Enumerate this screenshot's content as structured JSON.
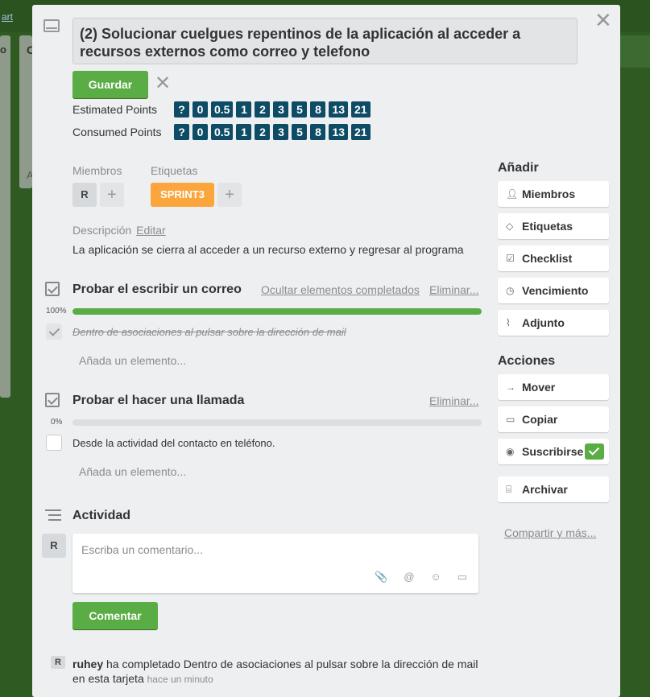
{
  "background": {
    "top_link": "art",
    "list_letter_1": "o",
    "list_letter_2": "C",
    "list_letter_3": "A"
  },
  "card": {
    "title": "(2) Solucionar cuelgues repentinos de la aplicación al acceder a recursos externos como correo y telefono",
    "save_label": "Guardar",
    "estimated_label": "Estimated Points",
    "consumed_label": "Consumed Points",
    "points": [
      "?",
      "0",
      "0.5",
      "1",
      "2",
      "3",
      "5",
      "8",
      "13",
      "21"
    ],
    "members_label": "Miembros",
    "member_avatar": "R",
    "labels_label": "Etiquetas",
    "label_sprint": "SPRINT3",
    "plus": "+",
    "description_label": "Descripción",
    "description_edit": "Editar",
    "description_text": "La aplicación se cierra al acceder a un recurso externo y regresar al programa"
  },
  "checklists": [
    {
      "title": "Probar el escribir un correo",
      "hide_completed": "Ocultar elementos completados",
      "delete": "Eliminar...",
      "percent_label": "100%",
      "progress": 1.0,
      "items": [
        {
          "text": "Dentro de asociaciones al pulsar sobre la dirección de mail",
          "done": true
        }
      ],
      "add_item": "Añada un elemento..."
    },
    {
      "title": "Probar el hacer una llamada",
      "delete": "Eliminar...",
      "percent_label": "0%",
      "progress": 0.0,
      "items": [
        {
          "text": "Desde la actividad del contacto en teléfono.",
          "done": false
        }
      ],
      "add_item": "Añada un elemento..."
    }
  ],
  "activity": {
    "title": "Actividad",
    "avatar": "R",
    "comment_placeholder": "Escriba un comentario...",
    "comment_button": "Comentar",
    "log_user": "ruhey",
    "log_text": "ha completado Dentro de asociaciones al pulsar sobre la dirección de mail en esta tarjeta",
    "log_time": "hace un minuto",
    "log_avatar": "R"
  },
  "sidebar": {
    "add_title": "Añadir",
    "add_items": [
      {
        "label": "Miembros",
        "icon": "person-icon"
      },
      {
        "label": "Etiquetas",
        "icon": "tag-icon"
      },
      {
        "label": "Checklist",
        "icon": "checklist-icon"
      },
      {
        "label": "Vencimiento",
        "icon": "clock-icon"
      },
      {
        "label": "Adjunto",
        "icon": "paperclip-icon"
      }
    ],
    "actions_title": "Acciones",
    "action_items": [
      {
        "label": "Mover",
        "icon": "arrow-right-icon"
      },
      {
        "label": "Copiar",
        "icon": "card-icon"
      },
      {
        "label": "Suscribirse",
        "icon": "eye-icon"
      },
      {
        "label": "Archivar",
        "icon": "archive-icon"
      }
    ],
    "share_link": "Compartir y más..."
  },
  "colors": {
    "green": "#5aac44",
    "points_badge": "#0e4c66",
    "label_orange": "#faa63d",
    "modal_bg": "#edeff0"
  }
}
